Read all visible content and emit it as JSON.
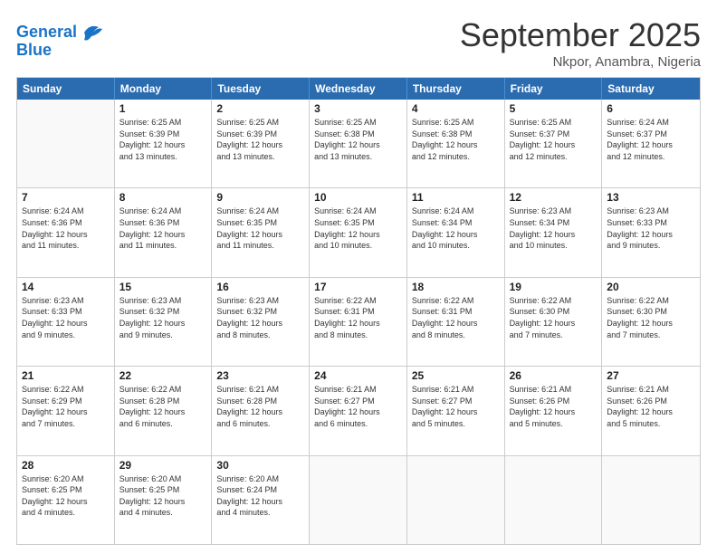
{
  "logo": {
    "line1": "General",
    "line2": "Blue"
  },
  "title": "September 2025",
  "subtitle": "Nkpor, Anambra, Nigeria",
  "header_days": [
    "Sunday",
    "Monday",
    "Tuesday",
    "Wednesday",
    "Thursday",
    "Friday",
    "Saturday"
  ],
  "weeks": [
    [
      {
        "day": "",
        "info": ""
      },
      {
        "day": "1",
        "info": "Sunrise: 6:25 AM\nSunset: 6:39 PM\nDaylight: 12 hours\nand 13 minutes."
      },
      {
        "day": "2",
        "info": "Sunrise: 6:25 AM\nSunset: 6:39 PM\nDaylight: 12 hours\nand 13 minutes."
      },
      {
        "day": "3",
        "info": "Sunrise: 6:25 AM\nSunset: 6:38 PM\nDaylight: 12 hours\nand 13 minutes."
      },
      {
        "day": "4",
        "info": "Sunrise: 6:25 AM\nSunset: 6:38 PM\nDaylight: 12 hours\nand 12 minutes."
      },
      {
        "day": "5",
        "info": "Sunrise: 6:25 AM\nSunset: 6:37 PM\nDaylight: 12 hours\nand 12 minutes."
      },
      {
        "day": "6",
        "info": "Sunrise: 6:24 AM\nSunset: 6:37 PM\nDaylight: 12 hours\nand 12 minutes."
      }
    ],
    [
      {
        "day": "7",
        "info": "Sunrise: 6:24 AM\nSunset: 6:36 PM\nDaylight: 12 hours\nand 11 minutes."
      },
      {
        "day": "8",
        "info": "Sunrise: 6:24 AM\nSunset: 6:36 PM\nDaylight: 12 hours\nand 11 minutes."
      },
      {
        "day": "9",
        "info": "Sunrise: 6:24 AM\nSunset: 6:35 PM\nDaylight: 12 hours\nand 11 minutes."
      },
      {
        "day": "10",
        "info": "Sunrise: 6:24 AM\nSunset: 6:35 PM\nDaylight: 12 hours\nand 10 minutes."
      },
      {
        "day": "11",
        "info": "Sunrise: 6:24 AM\nSunset: 6:34 PM\nDaylight: 12 hours\nand 10 minutes."
      },
      {
        "day": "12",
        "info": "Sunrise: 6:23 AM\nSunset: 6:34 PM\nDaylight: 12 hours\nand 10 minutes."
      },
      {
        "day": "13",
        "info": "Sunrise: 6:23 AM\nSunset: 6:33 PM\nDaylight: 12 hours\nand 9 minutes."
      }
    ],
    [
      {
        "day": "14",
        "info": "Sunrise: 6:23 AM\nSunset: 6:33 PM\nDaylight: 12 hours\nand 9 minutes."
      },
      {
        "day": "15",
        "info": "Sunrise: 6:23 AM\nSunset: 6:32 PM\nDaylight: 12 hours\nand 9 minutes."
      },
      {
        "day": "16",
        "info": "Sunrise: 6:23 AM\nSunset: 6:32 PM\nDaylight: 12 hours\nand 8 minutes."
      },
      {
        "day": "17",
        "info": "Sunrise: 6:22 AM\nSunset: 6:31 PM\nDaylight: 12 hours\nand 8 minutes."
      },
      {
        "day": "18",
        "info": "Sunrise: 6:22 AM\nSunset: 6:31 PM\nDaylight: 12 hours\nand 8 minutes."
      },
      {
        "day": "19",
        "info": "Sunrise: 6:22 AM\nSunset: 6:30 PM\nDaylight: 12 hours\nand 7 minutes."
      },
      {
        "day": "20",
        "info": "Sunrise: 6:22 AM\nSunset: 6:30 PM\nDaylight: 12 hours\nand 7 minutes."
      }
    ],
    [
      {
        "day": "21",
        "info": "Sunrise: 6:22 AM\nSunset: 6:29 PM\nDaylight: 12 hours\nand 7 minutes."
      },
      {
        "day": "22",
        "info": "Sunrise: 6:22 AM\nSunset: 6:28 PM\nDaylight: 12 hours\nand 6 minutes."
      },
      {
        "day": "23",
        "info": "Sunrise: 6:21 AM\nSunset: 6:28 PM\nDaylight: 12 hours\nand 6 minutes."
      },
      {
        "day": "24",
        "info": "Sunrise: 6:21 AM\nSunset: 6:27 PM\nDaylight: 12 hours\nand 6 minutes."
      },
      {
        "day": "25",
        "info": "Sunrise: 6:21 AM\nSunset: 6:27 PM\nDaylight: 12 hours\nand 5 minutes."
      },
      {
        "day": "26",
        "info": "Sunrise: 6:21 AM\nSunset: 6:26 PM\nDaylight: 12 hours\nand 5 minutes."
      },
      {
        "day": "27",
        "info": "Sunrise: 6:21 AM\nSunset: 6:26 PM\nDaylight: 12 hours\nand 5 minutes."
      }
    ],
    [
      {
        "day": "28",
        "info": "Sunrise: 6:20 AM\nSunset: 6:25 PM\nDaylight: 12 hours\nand 4 minutes."
      },
      {
        "day": "29",
        "info": "Sunrise: 6:20 AM\nSunset: 6:25 PM\nDaylight: 12 hours\nand 4 minutes."
      },
      {
        "day": "30",
        "info": "Sunrise: 6:20 AM\nSunset: 6:24 PM\nDaylight: 12 hours\nand 4 minutes."
      },
      {
        "day": "",
        "info": ""
      },
      {
        "day": "",
        "info": ""
      },
      {
        "day": "",
        "info": ""
      },
      {
        "day": "",
        "info": ""
      }
    ]
  ]
}
